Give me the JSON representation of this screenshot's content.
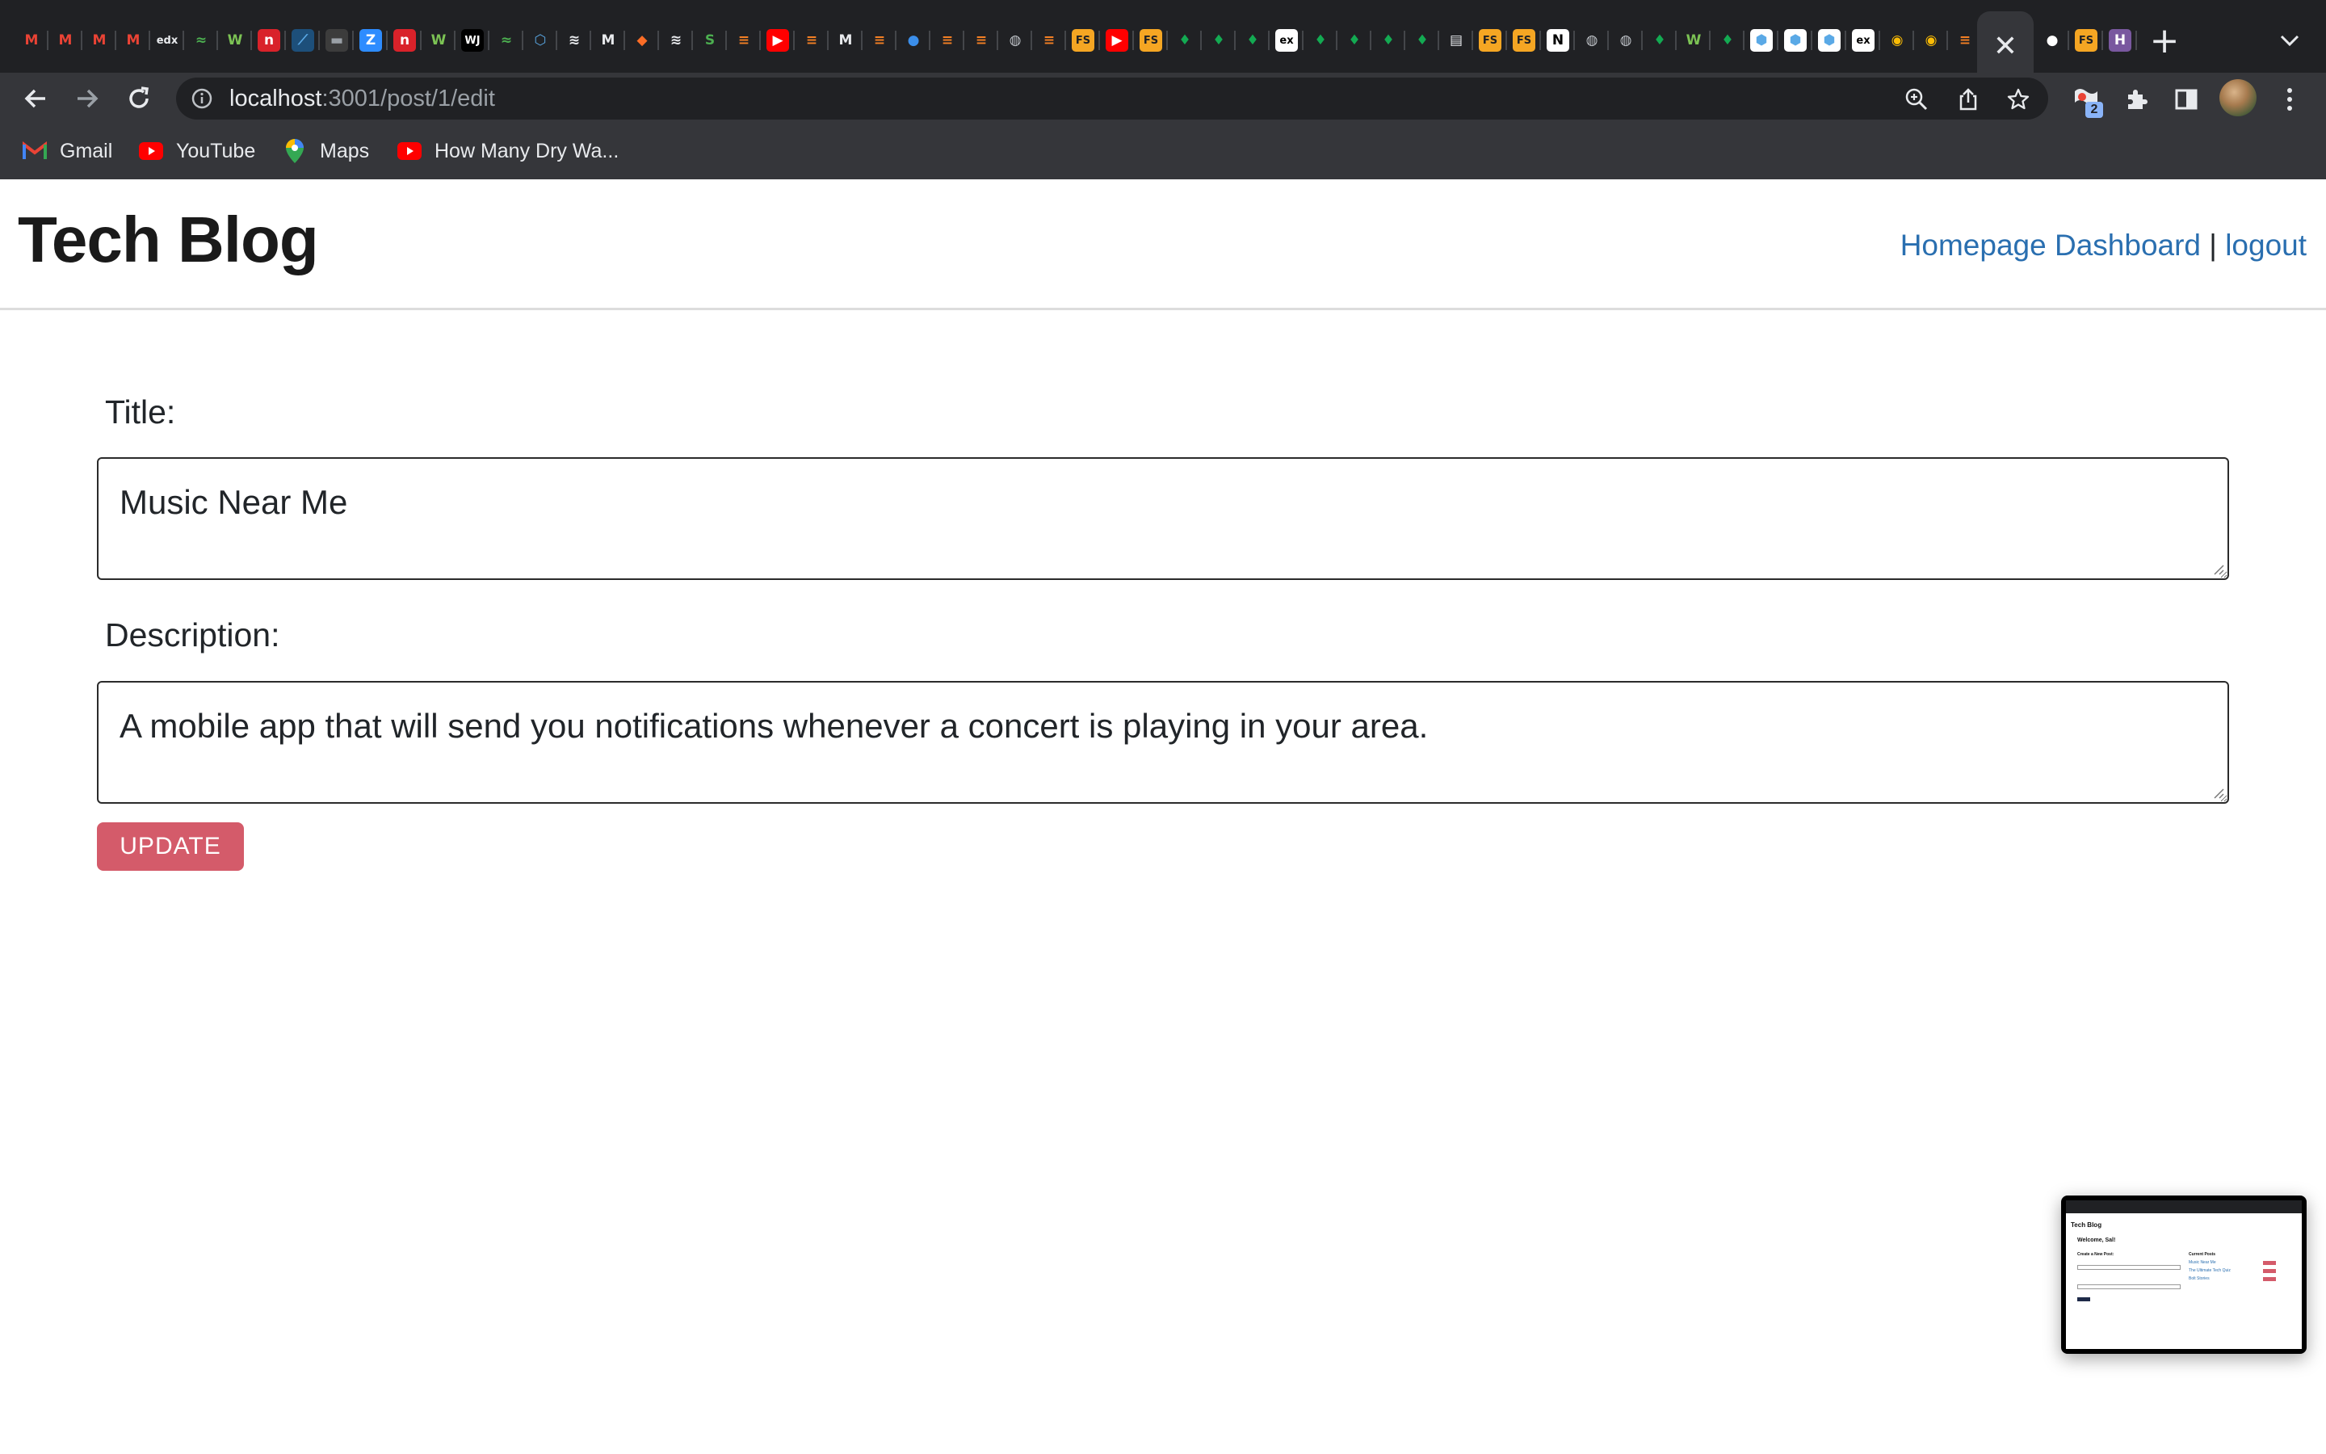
{
  "browser": {
    "tabs": [
      {
        "icon": "gmail-icon",
        "glyph": "M",
        "color": "#ea4335",
        "bg": "transparent"
      },
      {
        "icon": "gmail-icon",
        "glyph": "M",
        "color": "#ea4335",
        "bg": "transparent"
      },
      {
        "icon": "gmail-icon",
        "glyph": "M",
        "color": "#ea4335",
        "bg": "transparent"
      },
      {
        "icon": "gmail-icon",
        "glyph": "M",
        "color": "#ea4335",
        "bg": "transparent"
      },
      {
        "icon": "edx-icon",
        "glyph": "edx",
        "color": "#e8eaed",
        "bg": "transparent"
      },
      {
        "icon": "codeacademy-icon",
        "glyph": "≈",
        "color": "#4caf50",
        "bg": "transparent"
      },
      {
        "icon": "w-icon",
        "glyph": "W",
        "color": "#7cc354",
        "bg": "transparent"
      },
      {
        "icon": "n-icon",
        "glyph": "n",
        "color": "#ffffff",
        "bg": "#d9222a"
      },
      {
        "icon": "fiddle-icon",
        "glyph": "⟋",
        "color": "#5aa9e6",
        "bg": "#1d4f7a"
      },
      {
        "icon": "terminal-icon",
        "glyph": "▬",
        "color": "#9aa0a6",
        "bg": "#3c3c3c"
      },
      {
        "icon": "zoom-icon",
        "glyph": "Z",
        "color": "#ffffff",
        "bg": "#2d8cff"
      },
      {
        "icon": "n-icon",
        "glyph": "n",
        "color": "#ffffff",
        "bg": "#d9222a"
      },
      {
        "icon": "w-icon",
        "glyph": "W",
        "color": "#7cc354",
        "bg": "transparent"
      },
      {
        "icon": "wj-icon",
        "glyph": "WJ",
        "color": "#ffffff",
        "bg": "#000000"
      },
      {
        "icon": "codeacademy-icon",
        "glyph": "≈",
        "color": "#4caf50",
        "bg": "transparent"
      },
      {
        "icon": "cube-icon",
        "glyph": "⬡",
        "color": "#5aa9e6",
        "bg": "transparent"
      },
      {
        "icon": "wave-icon",
        "glyph": "≋",
        "color": "#e8eaed",
        "bg": "transparent"
      },
      {
        "icon": "medium-icon",
        "glyph": "M",
        "color": "#e8eaed",
        "bg": "transparent"
      },
      {
        "icon": "gitlab-icon",
        "glyph": "◆",
        "color": "#fc6d26",
        "bg": "transparent"
      },
      {
        "icon": "wave-icon",
        "glyph": "≋",
        "color": "#e8eaed",
        "bg": "transparent"
      },
      {
        "icon": "s-icon",
        "glyph": "S",
        "color": "#4caf50",
        "bg": "transparent"
      },
      {
        "icon": "stackoverflow-icon",
        "glyph": "≡",
        "color": "#f48024",
        "bg": "transparent"
      },
      {
        "icon": "youtube-icon",
        "glyph": "▶",
        "color": "#ffffff",
        "bg": "#ff0000"
      },
      {
        "icon": "stackoverflow-icon",
        "glyph": "≡",
        "color": "#f48024",
        "bg": "transparent"
      },
      {
        "icon": "medium-icon",
        "glyph": "M",
        "color": "#e8eaed",
        "bg": "transparent"
      },
      {
        "icon": "stackoverflow-icon",
        "glyph": "≡",
        "color": "#f48024",
        "bg": "transparent"
      },
      {
        "icon": "github-cat-icon",
        "glyph": "●",
        "color": "#3b8eea",
        "bg": "transparent"
      },
      {
        "icon": "stackoverflow-icon",
        "glyph": "≡",
        "color": "#f48024",
        "bg": "transparent"
      },
      {
        "icon": "stackoverflow-icon",
        "glyph": "≡",
        "color": "#f48024",
        "bg": "transparent"
      },
      {
        "icon": "globe-icon",
        "glyph": "◍",
        "color": "#bdc1c6",
        "bg": "transparent"
      },
      {
        "icon": "stackoverflow-icon",
        "glyph": "≡",
        "color": "#f48024",
        "bg": "transparent"
      },
      {
        "icon": "fs-icon",
        "glyph": "FS",
        "color": "#202124",
        "bg": "#f5a623"
      },
      {
        "icon": "youtube-icon",
        "glyph": "▶",
        "color": "#ffffff",
        "bg": "#ff0000"
      },
      {
        "icon": "fs-icon",
        "glyph": "FS",
        "color": "#202124",
        "bg": "#f5a623"
      },
      {
        "icon": "mongodb-icon",
        "glyph": "♦",
        "color": "#13aa52",
        "bg": "transparent"
      },
      {
        "icon": "mongodb-icon",
        "glyph": "♦",
        "color": "#13aa52",
        "bg": "transparent"
      },
      {
        "icon": "mongodb-icon",
        "glyph": "♦",
        "color": "#13aa52",
        "bg": "transparent"
      },
      {
        "icon": "express-icon",
        "glyph": "ex",
        "color": "#000000",
        "bg": "#ffffff"
      },
      {
        "icon": "mongodb-icon",
        "glyph": "♦",
        "color": "#13aa52",
        "bg": "transparent"
      },
      {
        "icon": "mongodb-icon",
        "glyph": "♦",
        "color": "#13aa52",
        "bg": "transparent"
      },
      {
        "icon": "mongodb-icon",
        "glyph": "♦",
        "color": "#13aa52",
        "bg": "transparent"
      },
      {
        "icon": "mongodb-icon",
        "glyph": "♦",
        "color": "#13aa52",
        "bg": "transparent"
      },
      {
        "icon": "newspaper-icon",
        "glyph": "▤",
        "color": "#e8eaed",
        "bg": "transparent"
      },
      {
        "icon": "fs-icon",
        "glyph": "FS",
        "color": "#202124",
        "bg": "#f5a623"
      },
      {
        "icon": "fs-icon",
        "glyph": "FS",
        "color": "#202124",
        "bg": "#f5a623"
      },
      {
        "icon": "notion-icon",
        "glyph": "N",
        "color": "#000000",
        "bg": "#ffffff"
      },
      {
        "icon": "globe-icon",
        "glyph": "◍",
        "color": "#bdc1c6",
        "bg": "transparent"
      },
      {
        "icon": "globe-icon",
        "glyph": "◍",
        "color": "#bdc1c6",
        "bg": "transparent"
      },
      {
        "icon": "mongodb-icon",
        "glyph": "♦",
        "color": "#13aa52",
        "bg": "transparent"
      },
      {
        "icon": "w-icon",
        "glyph": "W",
        "color": "#7cc354",
        "bg": "transparent"
      },
      {
        "icon": "mongodb-icon",
        "glyph": "♦",
        "color": "#13aa52",
        "bg": "transparent"
      },
      {
        "icon": "hex-icon",
        "glyph": "⬢",
        "color": "#5aa9e6",
        "bg": "#ffffff"
      },
      {
        "icon": "hex-icon",
        "glyph": "⬢",
        "color": "#5aa9e6",
        "bg": "#ffffff"
      },
      {
        "icon": "hex-icon",
        "glyph": "⬢",
        "color": "#5aa9e6",
        "bg": "#ffffff"
      },
      {
        "icon": "express-icon",
        "glyph": "ex",
        "color": "#000000",
        "bg": "#ffffff"
      },
      {
        "icon": "chrome-icon",
        "glyph": "◉",
        "color": "#fbbc05",
        "bg": "transparent"
      },
      {
        "icon": "chrome-icon",
        "glyph": "◉",
        "color": "#fbbc05",
        "bg": "transparent"
      },
      {
        "icon": "stackoverflow-icon",
        "glyph": "≡",
        "color": "#f48024",
        "bg": "transparent"
      },
      {
        "icon": "mongodb-icon",
        "glyph": "♦",
        "color": "#13aa52",
        "bg": "transparent"
      }
    ],
    "tabs_after_active": [
      {
        "icon": "github-icon",
        "glyph": "●",
        "color": "#ffffff",
        "bg": "transparent"
      },
      {
        "icon": "fs-icon",
        "glyph": "FS",
        "color": "#202124",
        "bg": "#f5a623"
      },
      {
        "icon": "heroku-icon",
        "glyph": "H",
        "color": "#ffffff",
        "bg": "#79589f"
      }
    ],
    "active_tab_close": "✕",
    "new_tab": "+",
    "url_host": "localhost",
    "url_path": ":3001/post/1/edit",
    "extension_badge": "2",
    "bookmarks": [
      {
        "label": "Gmail",
        "icon": "gmail-icon"
      },
      {
        "label": "YouTube",
        "icon": "youtube-icon"
      },
      {
        "label": "Maps",
        "icon": "maps-icon"
      },
      {
        "label": "How Many Dry Wa...",
        "icon": "youtube-icon"
      }
    ]
  },
  "page": {
    "site_title": "Tech Blog",
    "nav": {
      "homepage": "Homepage",
      "dashboard": "Dashboard",
      "separator": "|",
      "logout": "logout"
    },
    "form": {
      "title_label": "Title:",
      "title_value": "Music Near Me",
      "description_label": "Description:",
      "description_value": "A mobile app that will send you notifications whenever a concert is playing in your area.",
      "update_button": "UPDATE"
    }
  },
  "pip_preview": {
    "title": "Tech Blog",
    "welcome": "Welcome, Sal!",
    "create_heading": "Create a New Post:",
    "current_heading": "Current Posts",
    "posts": [
      "Music Near Me",
      "The Ultimate Tech Quiz",
      "Bolt Stories"
    ]
  },
  "colors": {
    "accent_link": "#2a6fb0",
    "update_button": "#d45b6a",
    "chrome_dark": "#202124",
    "chrome_toolbar": "#35363a"
  }
}
